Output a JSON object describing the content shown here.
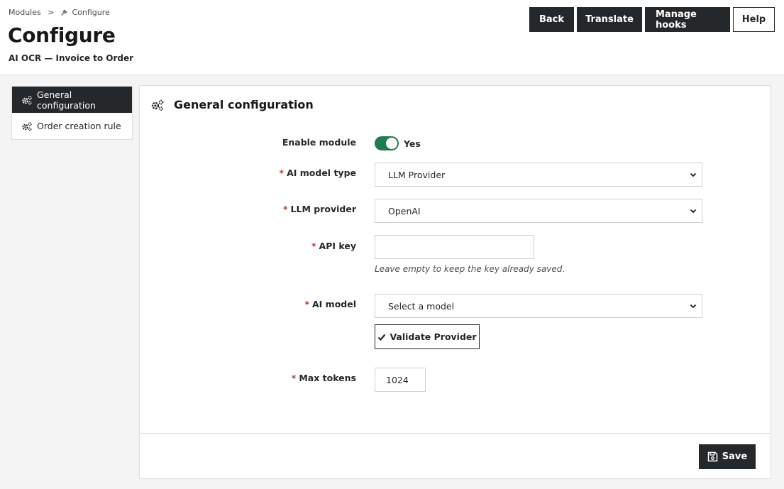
{
  "breadcrumb": {
    "parent": "Modules",
    "separator": ">",
    "current": "Configure",
    "current_icon": "wrench-icon"
  },
  "header": {
    "title": "Configure",
    "subtitle": "AI OCR — Invoice to Order"
  },
  "toolbar": {
    "back": "Back",
    "translate": "Translate",
    "manage_hooks": "Manage hooks",
    "help": "Help"
  },
  "side_nav": {
    "items": [
      {
        "label": "General configuration",
        "icon": "gears-icon",
        "active": true
      },
      {
        "label": "Order creation rule",
        "icon": "gears-icon",
        "active": false
      }
    ]
  },
  "panel": {
    "title": "General configuration",
    "title_icon": "gears-icon",
    "fields": {
      "enable_module": {
        "label": "Enable module",
        "state_text": "Yes",
        "enabled": true
      },
      "ai_model_type": {
        "required_mark": "*",
        "label": "AI model type",
        "value": "LLM Provider"
      },
      "llm_provider": {
        "required_mark": "*",
        "label": "LLM provider",
        "value": "OpenAI"
      },
      "api_key": {
        "required_mark": "*",
        "label": "API key",
        "value": "",
        "help": "Leave empty to keep the key already saved."
      },
      "ai_model": {
        "required_mark": "*",
        "label": "AI model",
        "value": "Select a model"
      },
      "validate_button": "Validate Provider",
      "max_tokens": {
        "required_mark": "*",
        "label": "Max tokens",
        "value": "1024"
      }
    },
    "save_button": "Save"
  },
  "colors": {
    "dark": "#25282b",
    "toggle_on": "#1e7e4a",
    "required": "#c0392b"
  }
}
